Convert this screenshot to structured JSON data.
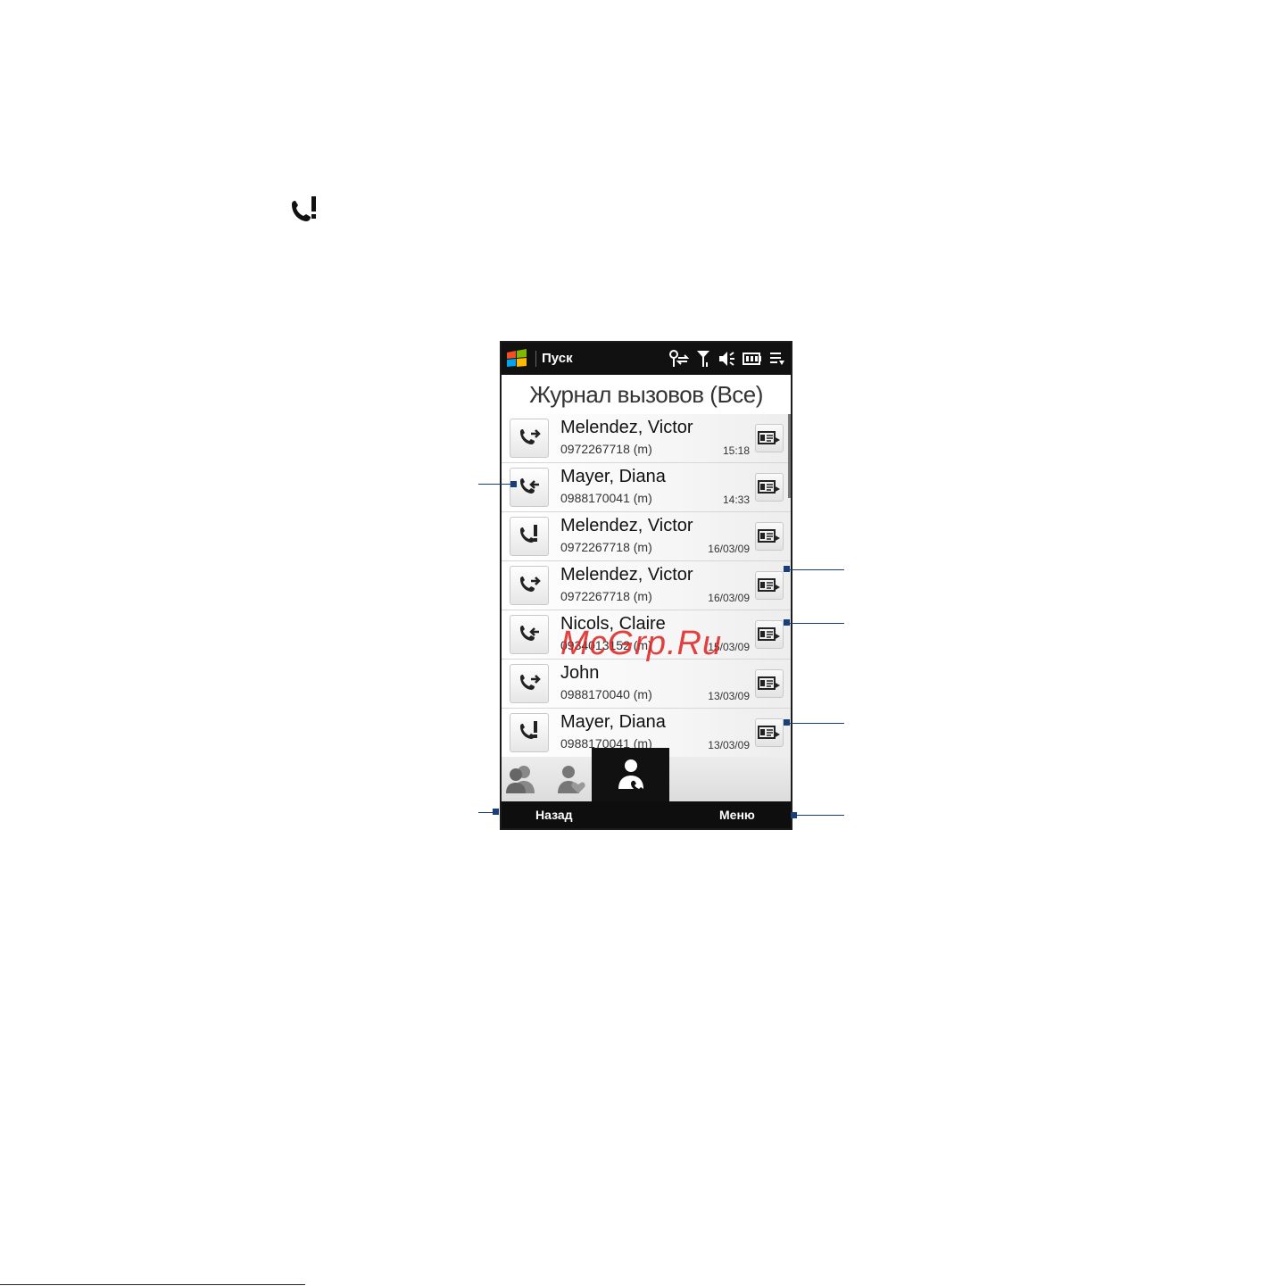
{
  "status_bar": {
    "start_label": "Пуск"
  },
  "screen_title": "Журнал вызовов (Все)",
  "calls": [
    {
      "type": "outgoing",
      "name": "Melendez, Victor",
      "number": "0972267718 (m)",
      "time": "15:18"
    },
    {
      "type": "incoming",
      "name": "Mayer, Diana",
      "number": "0988170041 (m)",
      "time": "14:33"
    },
    {
      "type": "missed",
      "name": "Melendez, Victor",
      "number": "0972267718 (m)",
      "time": "16/03/09"
    },
    {
      "type": "outgoing",
      "name": "Melendez, Victor",
      "number": "0972267718 (m)",
      "time": "16/03/09"
    },
    {
      "type": "incoming",
      "name": "Nicols, Claire",
      "number": "0934013152 (m)",
      "time": "15/03/09"
    },
    {
      "type": "outgoing",
      "name": "John",
      "number": "0988170040 (m)",
      "time": "13/03/09"
    },
    {
      "type": "missed",
      "name": "Mayer, Diana",
      "number": "0988170041 (m)",
      "time": "13/03/09"
    }
  ],
  "tabs": [
    "contacts-tab",
    "favorites-tab",
    "call-history-tab"
  ],
  "softkeys": {
    "left": "Назад",
    "right": "Меню"
  },
  "watermark": "McGrp.Ru",
  "colors": {
    "callout": "#1a3d7c",
    "status_bar": "#111111",
    "watermark": "#e02020"
  }
}
